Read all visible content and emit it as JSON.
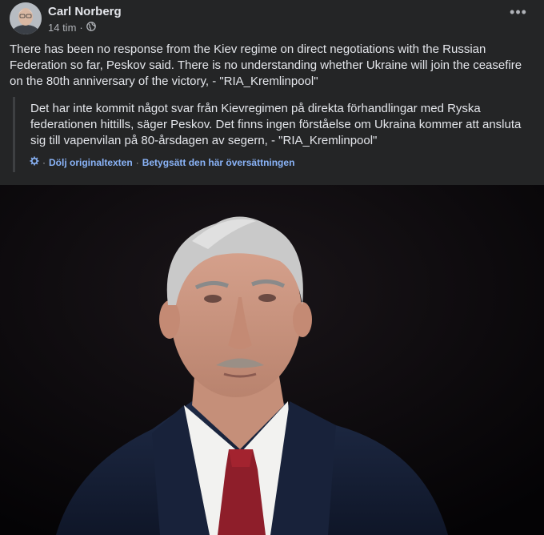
{
  "post": {
    "author": "Carl Norberg",
    "time": "14 tim",
    "separator": "·",
    "more_label": "•••",
    "text": "There has been no response from the Kiev regime on direct negotiations with the Russian Federation so far, Peskov said. There is no understanding whether Ukraine will join the ceasefire on the 80th anniversary of the victory, - \"RIA_Kremlinpool\"",
    "translation": {
      "text": "Det har inte kommit något svar från Kievregimen på direkta förhandlingar med Ryska federationen hittills, säger Peskov. Det finns ingen förståelse om Ukraina kommer att ansluta sig till vapenvilan på 80-årsdagen av segern, - \"RIA_Kremlinpool\"",
      "hide_original": "Dölj originaltexten",
      "rate_translation": "Betygsätt den här översättningen",
      "separator": "·"
    }
  },
  "colors": {
    "background": "#242526",
    "text": "#e4e6eb",
    "secondary": "#b0b3b8",
    "link": "#8ab4f8"
  },
  "icons": {
    "audience": "globe-icon",
    "translate": "gear-icon",
    "more": "more-options-icon"
  }
}
